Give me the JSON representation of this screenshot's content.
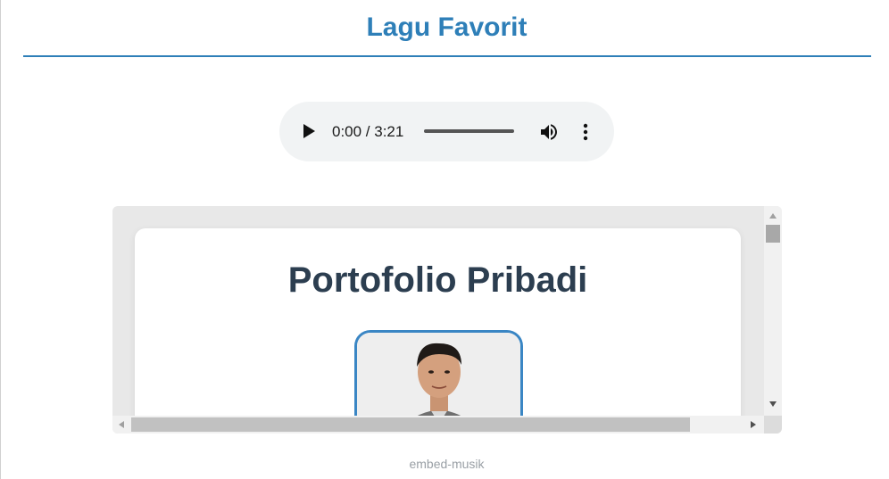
{
  "page": {
    "title": "Lagu Favorit",
    "caption": "embed-musik"
  },
  "audio": {
    "time_display": "0:00 / 3:21",
    "progress": 0,
    "icons": [
      "play-icon",
      "volume-icon",
      "more-options-icon"
    ]
  },
  "embed": {
    "heading": "Portofolio Pribadi",
    "photo_icon": "profile-photo"
  },
  "colors": {
    "accent": "#2e7fb8",
    "heading_dark": "#2c3e50",
    "player_bg": "#f1f3f4",
    "caption": "#9aa0a6"
  }
}
